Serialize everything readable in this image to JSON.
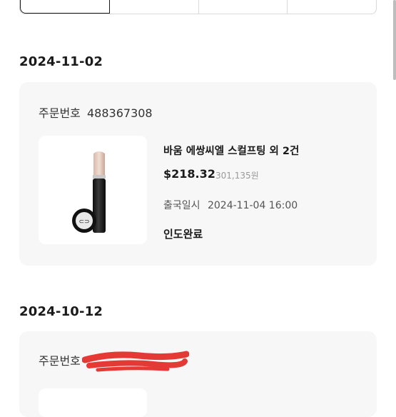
{
  "tabs": [
    {
      "label": ""
    },
    {
      "label": ""
    },
    {
      "label": ""
    },
    {
      "label": ""
    }
  ],
  "orders": [
    {
      "date": "2024-11-02",
      "order_label": "주문번호",
      "order_number": "488367308",
      "product_name": "바움 에쌍씨엘 스컬프팅  외 2건",
      "price_usd": "$218.32",
      "price_krw": "301,135원",
      "departure_label": "출국일시",
      "departure_datetime": "2024-11-04 16:00",
      "status": "인도완료"
    },
    {
      "date": "2024-10-12",
      "order_label": "주문번호",
      "order_number": "",
      "product_name": "",
      "price_usd": "",
      "price_krw": "",
      "departure_label": "",
      "departure_datetime": "",
      "status": ""
    }
  ],
  "colors": {
    "card_bg": "#f7f7f7",
    "redaction": "#e53935"
  }
}
